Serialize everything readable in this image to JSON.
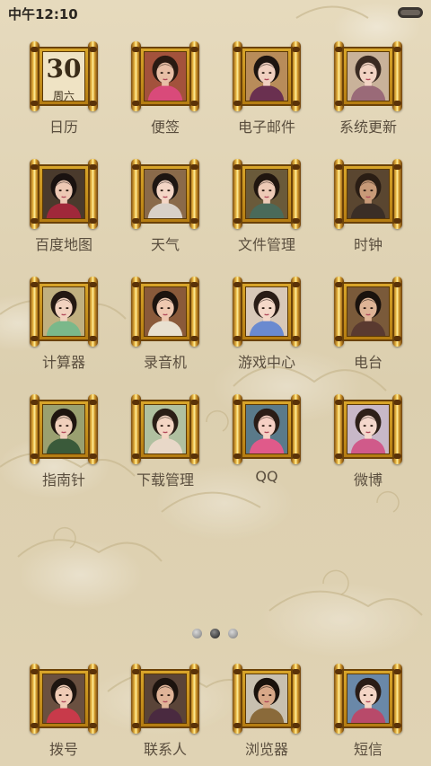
{
  "status": {
    "time": "中午12:10"
  },
  "calendar": {
    "day": "30",
    "weekday": "周六"
  },
  "apps": [
    {
      "label": "日历",
      "face": "calendar"
    },
    {
      "label": "便签",
      "face": "portrait",
      "skin": "#e8bfa6",
      "hair": "#2a1a12",
      "bg": "#a3523c",
      "top": "#d94a7a"
    },
    {
      "label": "电子邮件",
      "face": "portrait",
      "skin": "#f0d0c0",
      "hair": "#1c1410",
      "bg": "#b88c5a",
      "top": "#6a3050"
    },
    {
      "label": "系统更新",
      "face": "portrait",
      "skin": "#f2d4c4",
      "hair": "#3a2a22",
      "bg": "#c9b29a",
      "top": "#9a6a78"
    },
    {
      "label": "百度地图",
      "face": "portrait",
      "skin": "#edc8b4",
      "hair": "#1a1210",
      "bg": "#4a3a2c",
      "top": "#a0283a"
    },
    {
      "label": "天气",
      "face": "portrait",
      "skin": "#f4d6c6",
      "hair": "#1e1612",
      "bg": "#8a6a4a",
      "top": "#d8d0c8"
    },
    {
      "label": "文件管理",
      "face": "portrait",
      "skin": "#edcab6",
      "hair": "#20160f",
      "bg": "#6a5a3a",
      "top": "#4a6a5a"
    },
    {
      "label": "时钟",
      "face": "portrait",
      "skin": "#c89a78",
      "hair": "#2a1d14",
      "bg": "#5a4630",
      "top": "#3a2e26"
    },
    {
      "label": "计算器",
      "face": "portrait",
      "skin": "#f2d2bf",
      "hair": "#231812",
      "bg": "#c0b080",
      "top": "#7ab88a"
    },
    {
      "label": "录音机",
      "face": "portrait",
      "skin": "#eec8b0",
      "hair": "#1c130e",
      "bg": "#8a5a3a",
      "top": "#e8e0d0"
    },
    {
      "label": "游戏中心",
      "face": "portrait",
      "skin": "#f4d8c8",
      "hair": "#2a1c16",
      "bg": "#d8c8b8",
      "top": "#6a8ad0"
    },
    {
      "label": "电台",
      "face": "portrait",
      "skin": "#deb496",
      "hair": "#1a120d",
      "bg": "#7a5a3a",
      "top": "#5a3a30"
    },
    {
      "label": "指南针",
      "face": "portrait",
      "skin": "#f0d0bc",
      "hair": "#1e150f",
      "bg": "#9aa070",
      "top": "#3a5a3a"
    },
    {
      "label": "下载管理",
      "face": "portrait",
      "skin": "#f4d6c4",
      "hair": "#2a1e16",
      "bg": "#b0c0a0",
      "top": "#e8d8c8"
    },
    {
      "label": "QQ",
      "face": "portrait",
      "skin": "#f6d0c4",
      "hair": "#2a1c16",
      "bg": "#5a7a8a",
      "top": "#e05a8a"
    },
    {
      "label": "微博",
      "face": "portrait",
      "skin": "#f4d8cc",
      "hair": "#2e2018",
      "bg": "#c8b8c8",
      "top": "#d05a8a"
    }
  ],
  "dock": [
    {
      "label": "拨号",
      "face": "portrait",
      "skin": "#f0ccb6",
      "hair": "#1e1510",
      "bg": "#6a5040",
      "top": "#c83a4a"
    },
    {
      "label": "联系人",
      "face": "portrait",
      "skin": "#e0b498",
      "hair": "#1c130e",
      "bg": "#5a4438",
      "top": "#4a2a40"
    },
    {
      "label": "浏览器",
      "face": "portrait",
      "skin": "#d8a888",
      "hair": "#1a120c",
      "bg": "#c8c0b0",
      "top": "#8a6a3a"
    },
    {
      "label": "短信",
      "face": "portrait",
      "skin": "#f4d6c6",
      "hair": "#2a1c16",
      "bg": "#6a88a8",
      "top": "#b84a6a"
    }
  ],
  "pager": {
    "pages": 3,
    "active": 1
  }
}
